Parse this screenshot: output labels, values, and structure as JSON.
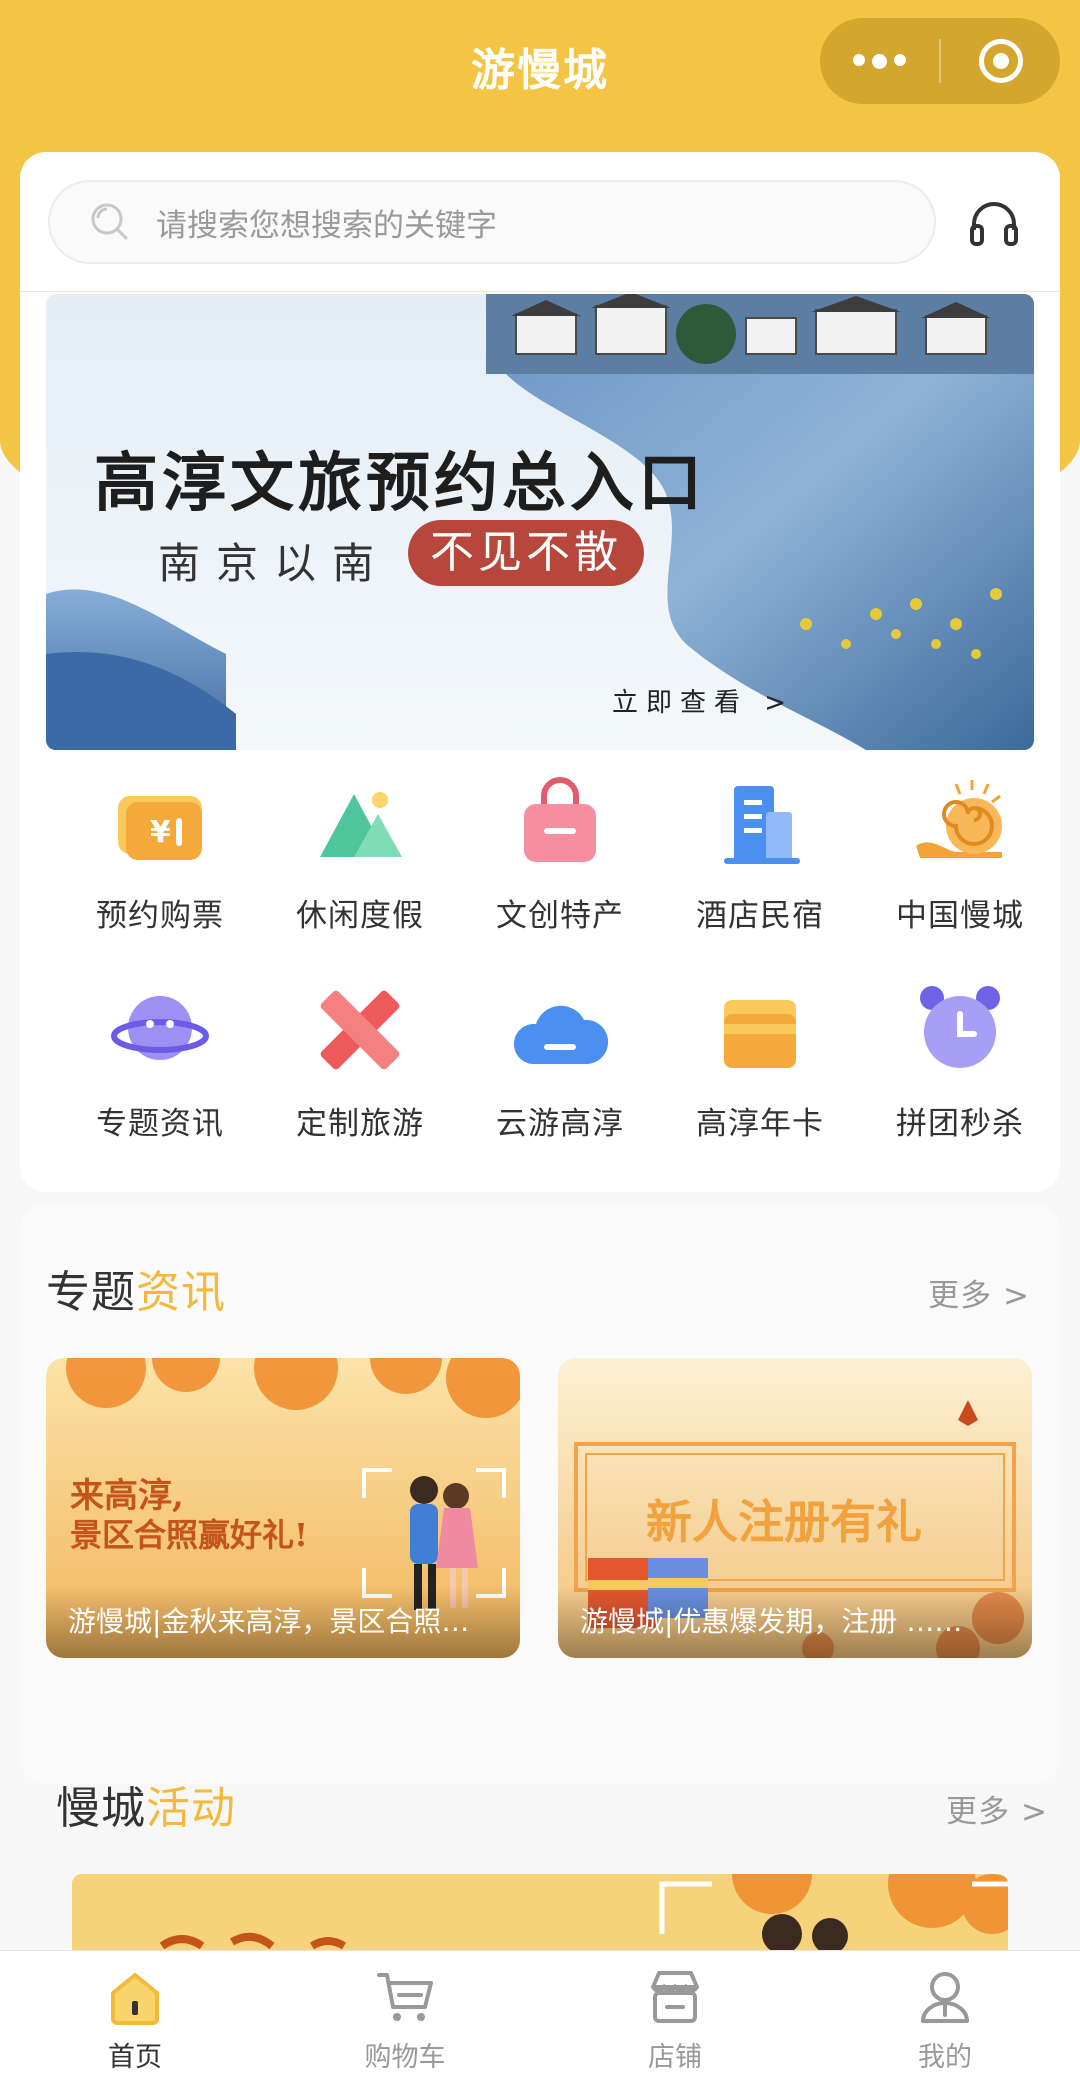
{
  "header": {
    "title": "游慢城"
  },
  "search": {
    "placeholder": "请搜索您想搜索的关键字"
  },
  "banner": {
    "title": "高淳文旅预约总入口",
    "subtitle": "南京以南",
    "highlight": "不见不散",
    "link": "立即查看 >"
  },
  "grid": [
    {
      "label": "预约购票",
      "icon": "ticket-icon",
      "color": "#f4b23a"
    },
    {
      "label": "休闲度假",
      "icon": "mountain-icon",
      "color": "#4fc59c"
    },
    {
      "label": "文创特产",
      "icon": "shopping-bag-icon",
      "color": "#f07b8a"
    },
    {
      "label": "酒店民宿",
      "icon": "building-icon",
      "color": "#4b8ff0"
    },
    {
      "label": "中国慢城",
      "icon": "snail-icon",
      "color": "#f4a23a"
    },
    {
      "label": "专题资讯",
      "icon": "planet-icon",
      "color": "#7d6ff0"
    },
    {
      "label": "定制旅游",
      "icon": "ruler-pencil-icon",
      "color": "#ee5a5a"
    },
    {
      "label": "云游高淳",
      "icon": "cloud-icon",
      "color": "#4b8ff0"
    },
    {
      "label": "高淳年卡",
      "icon": "card-icon",
      "color": "#f4b23a"
    },
    {
      "label": "拼团秒杀",
      "icon": "alarm-clock-icon",
      "color": "#8f86f0"
    }
  ],
  "news_section": {
    "title_main": "专题",
    "title_accent": "资讯",
    "more": "更多 >",
    "cards": [
      {
        "caption": "游慢城|金秋来高淳，景区合照…",
        "art_text_1": "来高淳,",
        "art_text_2": "景区合照赢好礼!"
      },
      {
        "caption": "游慢城|优惠爆发期，注册 ……",
        "art_text_1": "新人注册有礼"
      }
    ]
  },
  "activity_section": {
    "title_main": "慢城",
    "title_accent": "活动",
    "more": "更多 >"
  },
  "tabbar": [
    {
      "label": "首页",
      "icon": "home-icon",
      "active": true
    },
    {
      "label": "购物车",
      "icon": "cart-icon",
      "active": false
    },
    {
      "label": "店铺",
      "icon": "store-icon",
      "active": false
    },
    {
      "label": "我的",
      "icon": "profile-icon",
      "active": false
    }
  ],
  "colors": {
    "brand": "#f4c444",
    "accent": "#f4b83a",
    "banner_pill": "#b7473b"
  }
}
